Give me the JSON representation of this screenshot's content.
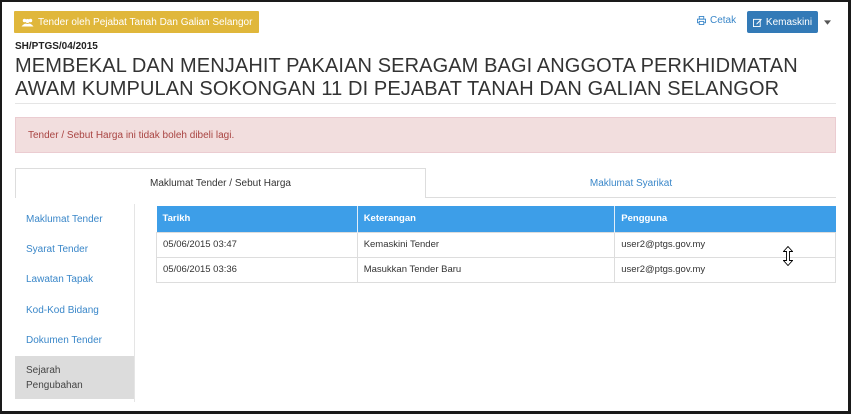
{
  "header": {
    "agency_button": "Tender oleh Pejabat Tanah Dan Galian Selangor",
    "print_label": "Cetak",
    "edit_label": "Kemaskini"
  },
  "tender": {
    "reference": "SH/PTGS/04/2015",
    "title": "MEMBEKAL DAN MENJAHIT PAKAIAN SERAGAM BAGI ANGGOTA PERKHIDMATAN AWAM KUMPULAN SOKONGAN 11 DI PEJABAT TANAH DAN GALIAN SELANGOR"
  },
  "alert": {
    "message": "Tender / Sebut Harga ini tidak boleh dibeli lagi."
  },
  "tabs": [
    {
      "label": "Maklumat Tender / Sebut Harga",
      "active": true
    },
    {
      "label": "Maklumat Syarikat",
      "active": false
    }
  ],
  "sidebar": {
    "items": [
      {
        "label": "Maklumat Tender"
      },
      {
        "label": "Syarat Tender"
      },
      {
        "label": "Lawatan Tapak"
      },
      {
        "label": "Kod-Kod Bidang"
      },
      {
        "label": "Dokumen Tender"
      },
      {
        "label": "Sejarah Pengubahan",
        "active": true
      }
    ]
  },
  "history_table": {
    "headers": [
      "Tarikh",
      "Keterangan",
      "Pengguna"
    ],
    "rows": [
      [
        "05/06/2015 03:47",
        "Kemaskini Tender",
        "user2@ptgs.gov.my"
      ],
      [
        "05/06/2015 03:36",
        "Masukkan Tender Baru",
        "user2@ptgs.gov.my"
      ]
    ]
  },
  "colors": {
    "agency_button": "#e0b73b",
    "primary_button": "#337ab7",
    "link": "#3a87c9",
    "table_header": "#3d9ee8",
    "alert_bg": "#f2dede",
    "alert_text": "#a94442",
    "active_sidebar_bg": "#dcdcdc"
  },
  "icons": {
    "agency_button": "users-icon",
    "print": "print-icon",
    "edit": "edit-icon",
    "dropdown": "caret-down-icon",
    "cursor": "vertical-resize-cursor-icon"
  }
}
